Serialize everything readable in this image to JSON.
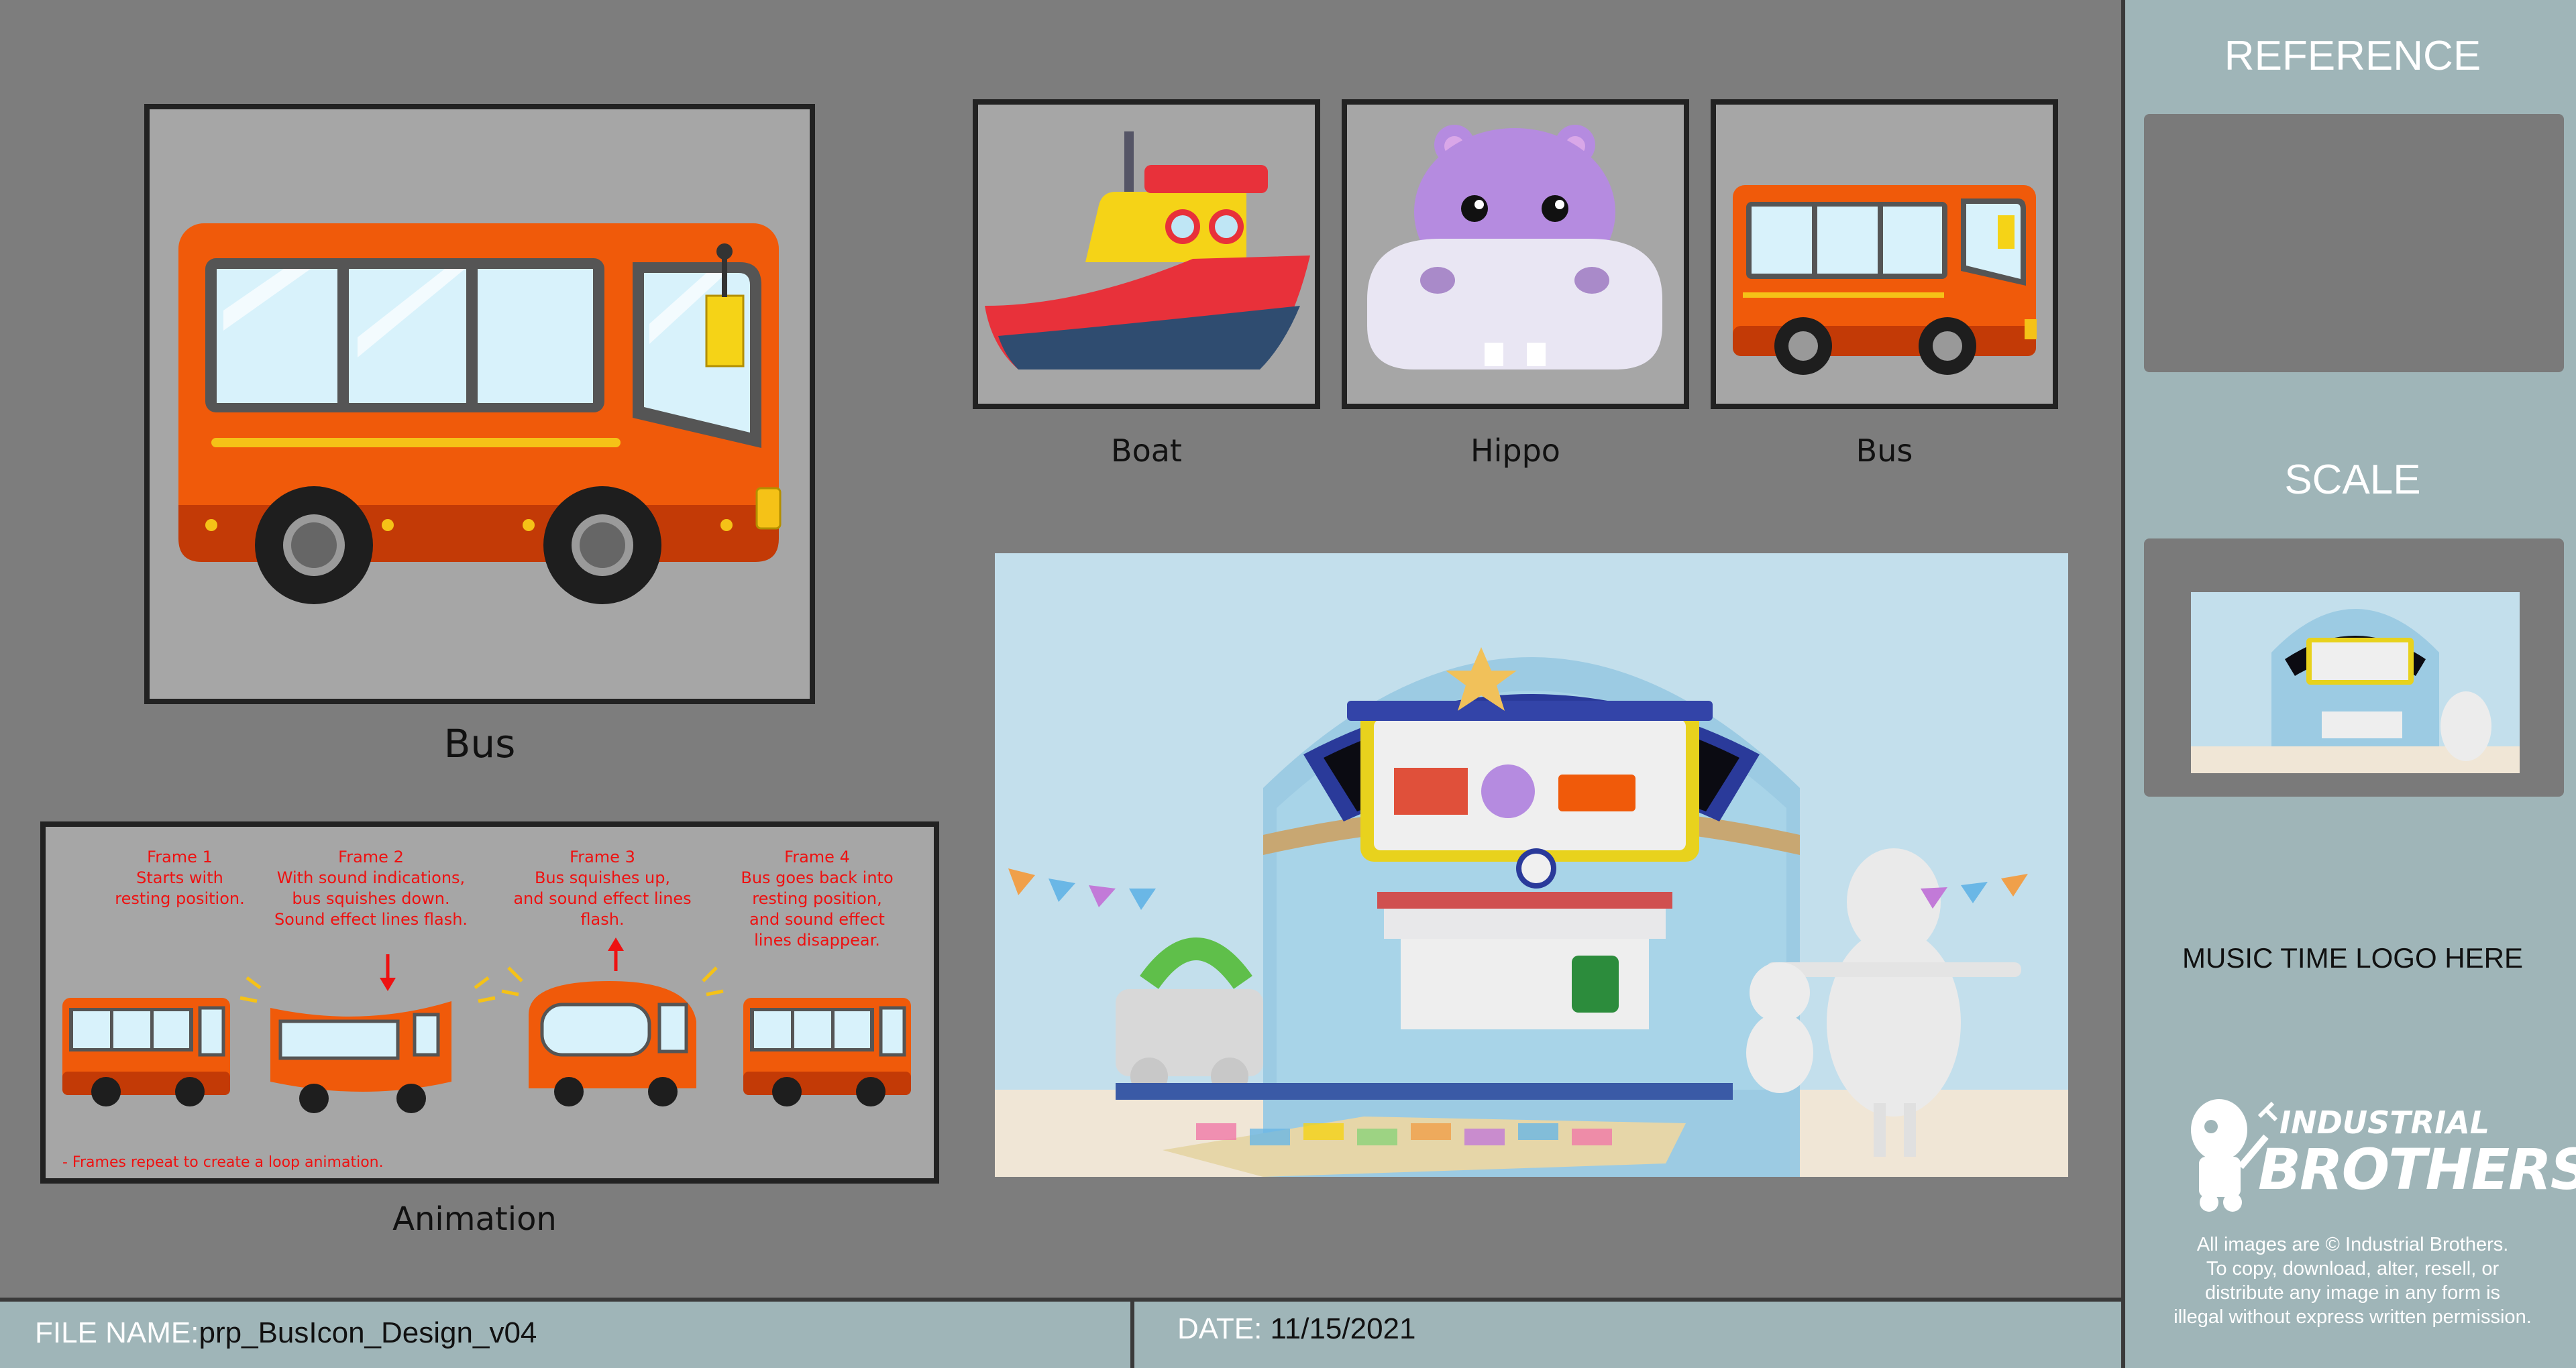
{
  "main_bus": {
    "caption": "Bus"
  },
  "icons": [
    {
      "id": "boat",
      "label": "Boat"
    },
    {
      "id": "hippo",
      "label": "Hippo"
    },
    {
      "id": "bus",
      "label": "Bus"
    }
  ],
  "animation": {
    "caption": "Animation",
    "frames": [
      {
        "title": "Frame 1",
        "lines": [
          "Starts with",
          "resting position."
        ]
      },
      {
        "title": "Frame 2",
        "lines": [
          "With sound indications,",
          "bus squishes down.",
          "Sound effect lines flash."
        ]
      },
      {
        "title": "Frame 3",
        "lines": [
          "Bus squishes up,",
          "and sound effect lines",
          "flash."
        ]
      },
      {
        "title": "Frame 4",
        "lines": [
          "Bus goes back into",
          "resting position,",
          "and sound effect",
          "lines disappear."
        ]
      }
    ],
    "note": "- Frames repeat to create a loop animation."
  },
  "sidebar": {
    "reference_title": "REFERENCE",
    "scale_title": "SCALE",
    "logo_placeholder": "MUSIC TIME LOGO HERE",
    "brand_line1": "INDUSTRIAL",
    "brand_line2": "BROTHERS",
    "copyright": [
      "All images are © Industrial Brothers.",
      "To copy, download, alter, resell, or",
      "distribute any image in any form is",
      "illegal without express written permission."
    ]
  },
  "footer": {
    "file_label": "FILE NAME:",
    "file_value": "prp_BusIcon_Design_v04",
    "date_label": "DATE:",
    "date_value": "11/15/2021"
  },
  "colors": {
    "bus_orange": "#f05a0a",
    "bus_dark": "#c33a06",
    "accent_yellow": "#f5d317",
    "sidebar_bg": "#9fb5b8",
    "frame_text": "#ee1111"
  }
}
